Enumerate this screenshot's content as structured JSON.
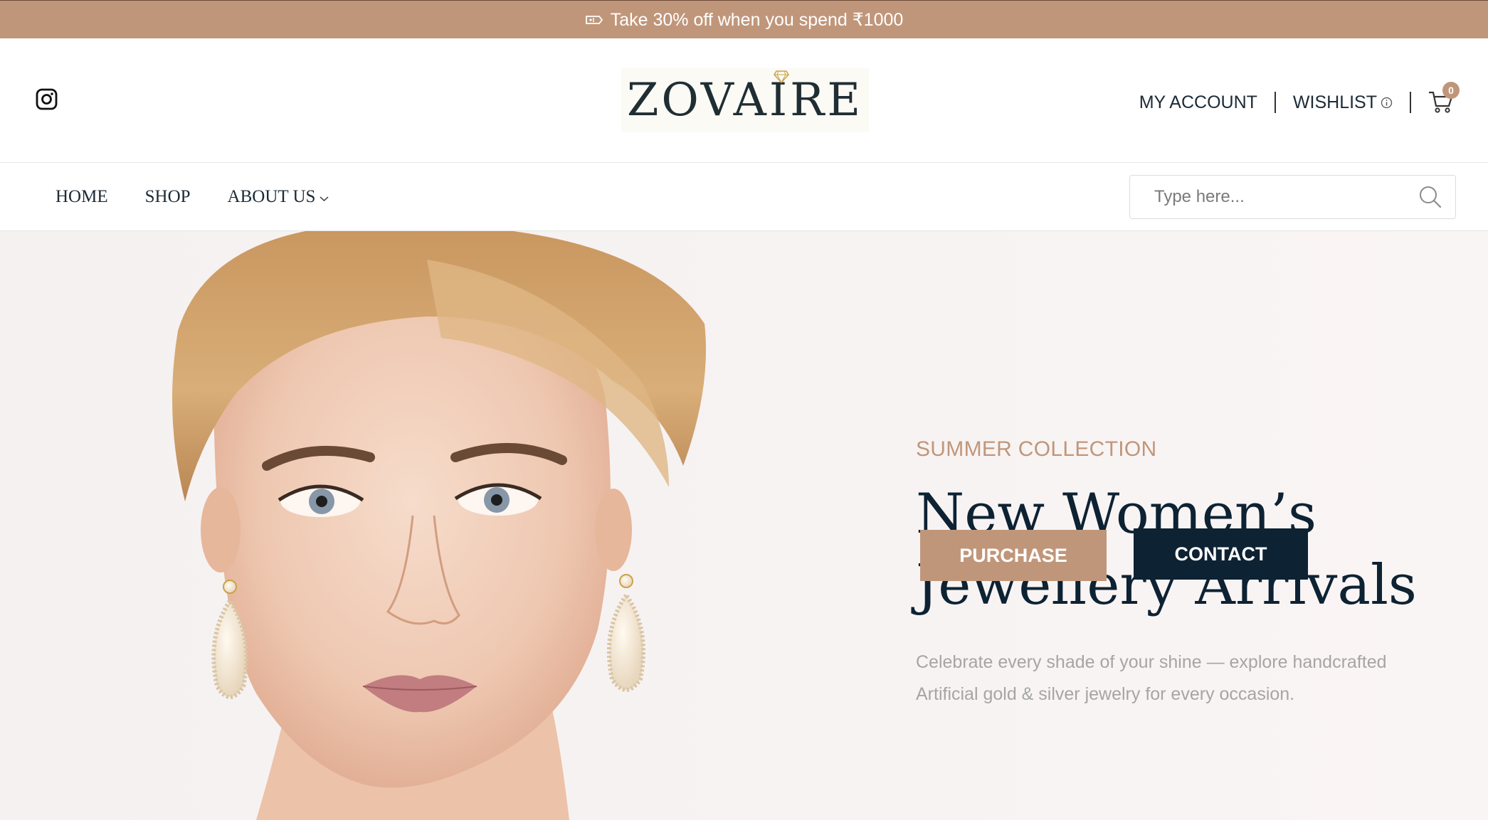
{
  "promo": {
    "text": "Take 30% off when you spend ₹1000",
    "icon": "ticket-icon"
  },
  "header": {
    "logo_text": "ZOVAIRE",
    "social_icon": "instagram-icon",
    "my_account": "MY ACCOUNT",
    "wishlist": "WISHLIST",
    "cart_count": "0"
  },
  "nav": {
    "items": [
      {
        "label": "HOME"
      },
      {
        "label": "SHOP"
      },
      {
        "label": "ABOUT US"
      }
    ],
    "search_placeholder": "Type here..."
  },
  "hero": {
    "eyebrow": "SUMMER COLLECTION",
    "headline_line1": "New Women’s",
    "headline_line2": "Jewellery Arrivals",
    "subtext": "Celebrate every shade of your shine — explore handcrafted Artificial gold & silver jewelry for every occasion.",
    "purchase_label": "PURCHASE",
    "contact_label": "CONTACT"
  },
  "colors": {
    "accent": "#c0967a",
    "navy": "#0d2233",
    "hero_bg": "#f8f3f3"
  }
}
